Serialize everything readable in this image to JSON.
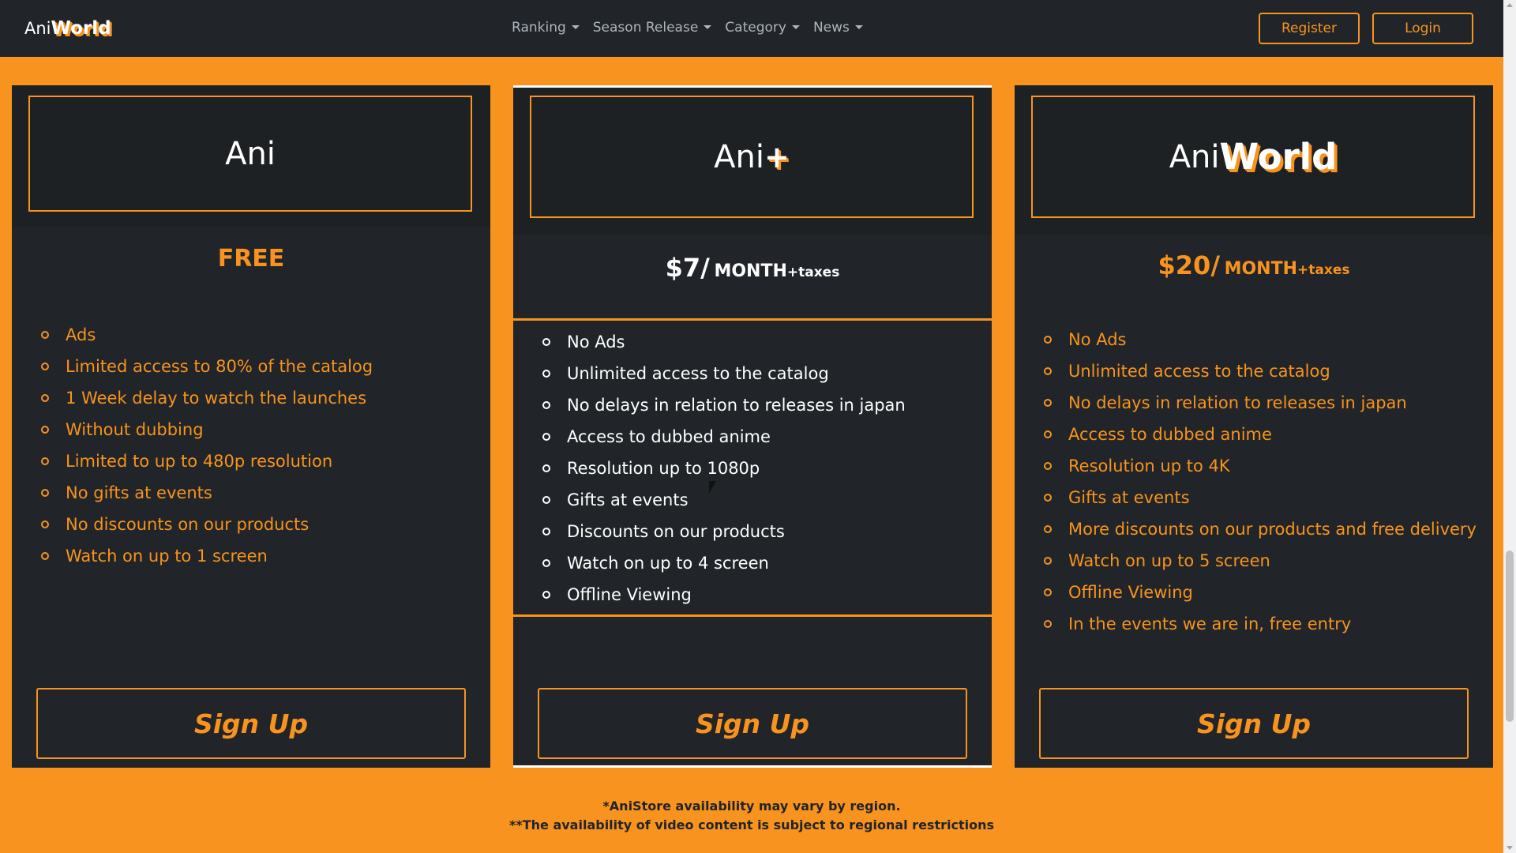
{
  "navbar": {
    "brand": {
      "ani": "Ani",
      "world": "World"
    },
    "links": [
      {
        "label": "Ranking"
      },
      {
        "label": "Season Release"
      },
      {
        "label": "Category"
      },
      {
        "label": "News"
      }
    ],
    "register_label": "Register",
    "login_label": "Login"
  },
  "plans": [
    {
      "logo": {
        "ani": "Ani",
        "suffix": ""
      },
      "price": "FREE",
      "features": [
        "Ads",
        "Limited access to 80% of the catalog",
        "1 Week delay to watch the launches",
        "Without dubbing",
        "Limited to up to 480p resolution",
        "No gifts at events",
        "No discounts on our products",
        "Watch on up to 1 screen"
      ],
      "signup_label": "Sign Up"
    },
    {
      "logo": {
        "ani": "Ani",
        "suffix": "+"
      },
      "price": {
        "amount": "$7/",
        "period": "MONTH",
        "tax": "+taxes"
      },
      "features": [
        "No Ads",
        "Unlimited access to the catalog",
        "No delays in relation to releases in japan",
        "Access to dubbed anime",
        "Resolution up to 1080p",
        "Gifts at events",
        "Discounts on our products",
        "Watch on up to 4 screen",
        "Offline Viewing"
      ],
      "signup_label": "Sign Up"
    },
    {
      "logo": {
        "ani": "Ani",
        "suffix": "World"
      },
      "price": {
        "amount": "$20/",
        "period": "MONTH",
        "tax": "+taxes"
      },
      "features": [
        "No Ads",
        "Unlimited access to the catalog",
        "No delays in relation to releases in japan",
        "Access to dubbed anime",
        "Resolution up to 4K",
        "Gifts at events",
        "More discounts on our products and free delivery",
        "Watch on up to 5 screen",
        "Offline Viewing",
        "In the events we are in, free entry"
      ],
      "signup_label": "Sign Up"
    }
  ],
  "footnotes": [
    "*AniStore availability may vary by region.",
    "**The availability of video content is subject to regional restrictions"
  ],
  "colors": {
    "accent": "#f7931e",
    "card": "#212529",
    "navbar": "#212529"
  }
}
